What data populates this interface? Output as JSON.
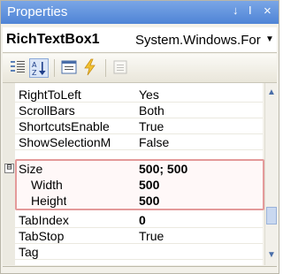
{
  "window": {
    "title": "Properties",
    "pin_glyph": "↓",
    "autohide_glyph": "I",
    "close_glyph": "×"
  },
  "object_selector": {
    "name": "RichTextBox1",
    "type": "System.Windows.For",
    "dropdown_glyph": "▼"
  },
  "toolbar": {
    "categorized_icon": "categorized-icon",
    "alphabetical_icon": "alphabetical-icon",
    "properties_icon": "properties-icon",
    "events_icon": "events-icon",
    "property_pages_icon": "property-pages-icon"
  },
  "grid": {
    "rows": [
      {
        "name": "RightToLeft",
        "value": "Yes"
      },
      {
        "name": "ScrollBars",
        "value": "Both"
      },
      {
        "name": "ShortcutsEnable",
        "value": "True"
      },
      {
        "name": "ShowSelectionM",
        "value": "False"
      },
      {
        "name": "Size",
        "value": "500; 500",
        "expander": "⊟"
      },
      {
        "name": "Width",
        "value": "500"
      },
      {
        "name": "Height",
        "value": "500"
      },
      {
        "name": "TabIndex",
        "value": "0"
      },
      {
        "name": "TabStop",
        "value": "True"
      },
      {
        "name": "Tag",
        "value": ""
      }
    ]
  },
  "scrollbar": {
    "up_glyph": "▲",
    "down_glyph": "▼"
  },
  "colors": {
    "title_bar": "#5b8ee0",
    "highlight_border": "#e49a9a"
  }
}
